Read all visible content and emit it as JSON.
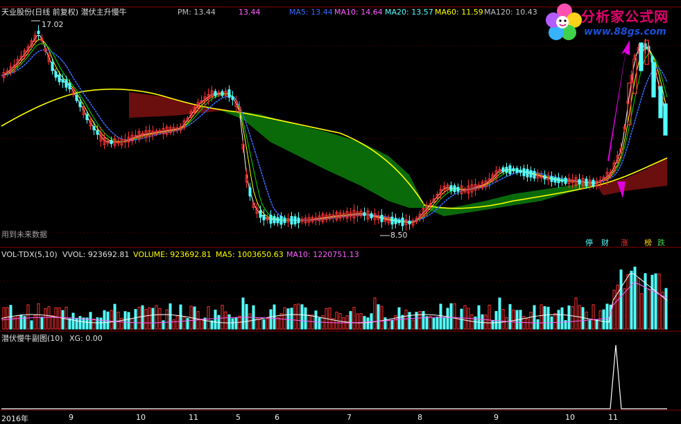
{
  "header": {
    "title": "天业股份(日线 前复权) 潜伏主升慢牛",
    "pm_label": "PM: 13.44",
    "pm_value": "13.44",
    "ma5": "MA5: 13.44",
    "ma10": "MA10: 14.64",
    "ma20": "MA20: 13.57",
    "ma60": "MA60: 11.59",
    "ma120": "MA120: 10.43"
  },
  "logo": {
    "title": "分析家公式网",
    "url": "www.88gs.com"
  },
  "main_chart": {
    "high_label": "17.02",
    "low_label": "8.50",
    "future_data_note": "用到未来数据",
    "badges": [
      "停",
      "财",
      "涨",
      "榜",
      "跌"
    ]
  },
  "volume_panel": {
    "name": "VOL-TDX(5,10)",
    "vvol": "VVOL: 923692.81",
    "volume": "VOLUME: 923692.81",
    "ma5": "MA5: 1003650.63",
    "ma10": "MA10: 1220751.13"
  },
  "indicator_panel": {
    "name": "潜伏慢牛副图(10)",
    "xg": "XG: 0.00"
  },
  "x_axis": [
    "2016年",
    "9",
    "10",
    "11",
    "5",
    "6",
    "7",
    "8",
    "9",
    "10",
    "11"
  ],
  "colors": {
    "up": "#ff3232",
    "down": "#54ffff",
    "ma_white": "#ffffff",
    "ma_yellow": "#ffff00",
    "ma_green": "#00e000",
    "ma_blue": "#3b6bff",
    "ribbon_green": "#0a6a0a",
    "ribbon_red": "#6a0e0e",
    "grid": "#8b0000",
    "arrow": "#e000e0"
  }
}
